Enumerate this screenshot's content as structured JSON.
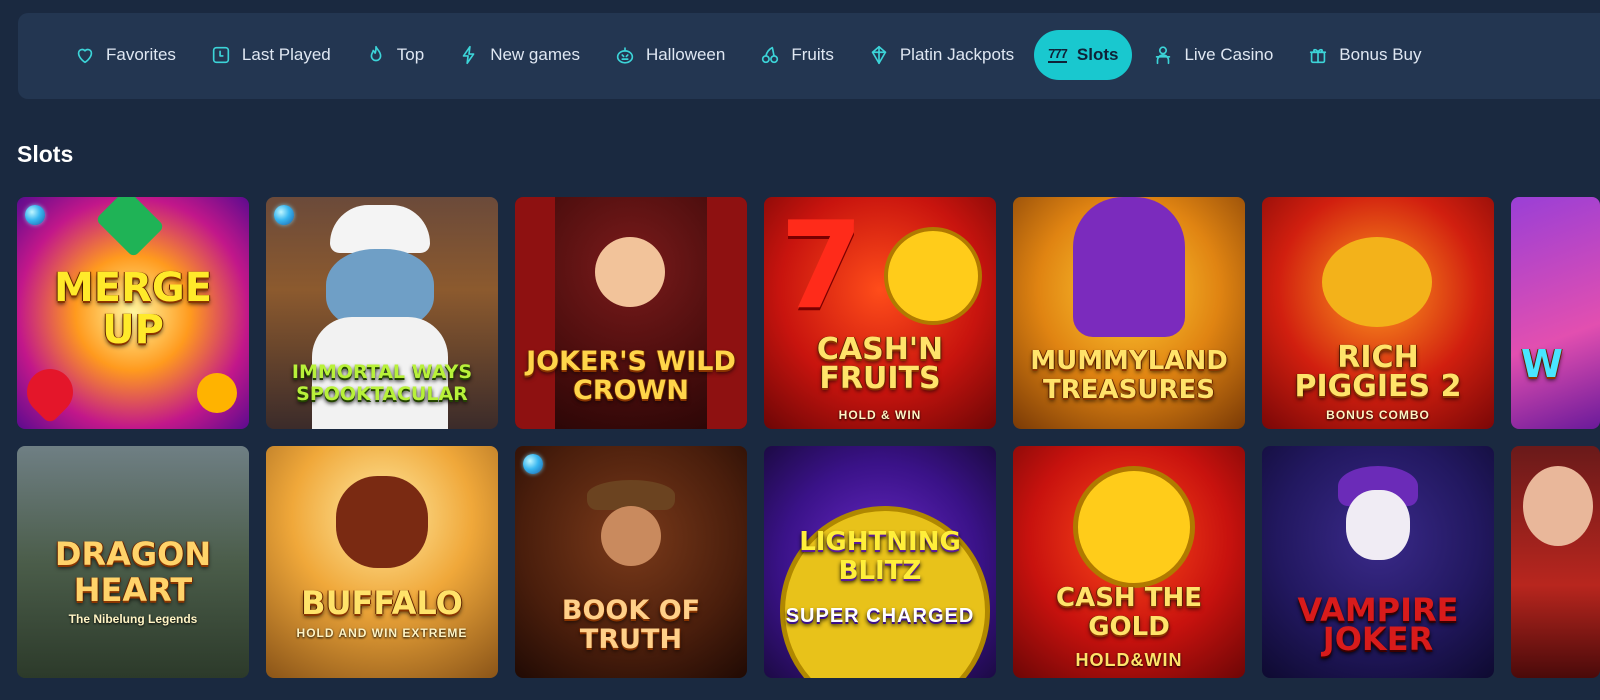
{
  "nav": {
    "items": [
      {
        "label": "Favorites",
        "icon": "heart-icon"
      },
      {
        "label": "Last Played",
        "icon": "clock-icon"
      },
      {
        "label": "Top",
        "icon": "flame-icon"
      },
      {
        "label": "New games",
        "icon": "lightning-icon"
      },
      {
        "label": "Halloween",
        "icon": "pumpkin-icon"
      },
      {
        "label": "Fruits",
        "icon": "cherries-icon"
      },
      {
        "label": "Platin Jackpots",
        "icon": "diamond-icon"
      },
      {
        "label": "Slots",
        "icon": "sevens-icon",
        "active": true,
        "icon_text": "777"
      },
      {
        "label": "Live Casino",
        "icon": "dealer-icon"
      },
      {
        "label": "Bonus Buy",
        "icon": "gift-icon"
      }
    ],
    "active_color": "#19c8cf"
  },
  "section": {
    "title": "Slots"
  },
  "games": {
    "row1": [
      {
        "title": "MERGE UP",
        "subtitle": "",
        "badge": true
      },
      {
        "title": "IMMORTAL WAYS SPOOKTACULAR",
        "subtitle": "",
        "badge": true
      },
      {
        "title": "JOKER'S Wild CROWN",
        "subtitle": "",
        "badge": false
      },
      {
        "title": "Cash'n Fruits",
        "subtitle": "HOLD & WIN",
        "badge": false
      },
      {
        "title": "MUMMYLAND TREASURES",
        "subtitle": "",
        "badge": false
      },
      {
        "title": "RICH PIGGIES 2",
        "subtitle": "BONUS COMBO",
        "badge": false
      },
      {
        "title": "W",
        "subtitle": "",
        "badge": false
      }
    ],
    "row2": [
      {
        "title": "DRAGON HEART",
        "subtitle": "The Nibelung Legends",
        "badge": false
      },
      {
        "title": "BUFFALO",
        "subtitle": "HOLD AND WIN EXTREME",
        "badge": false
      },
      {
        "title": "BOOK OF TRUTH",
        "subtitle": "",
        "badge": true
      },
      {
        "title": "LIGHTNING BLITZ",
        "subtitle": "SUPER CHARGED",
        "badge": false
      },
      {
        "title": "CASH THE GOLD",
        "subtitle": "HOLD&WIN",
        "badge": false
      },
      {
        "title": "VAMPIRE JOKER",
        "subtitle": "",
        "badge": false
      },
      {
        "title": "",
        "subtitle": "",
        "badge": false
      }
    ]
  }
}
